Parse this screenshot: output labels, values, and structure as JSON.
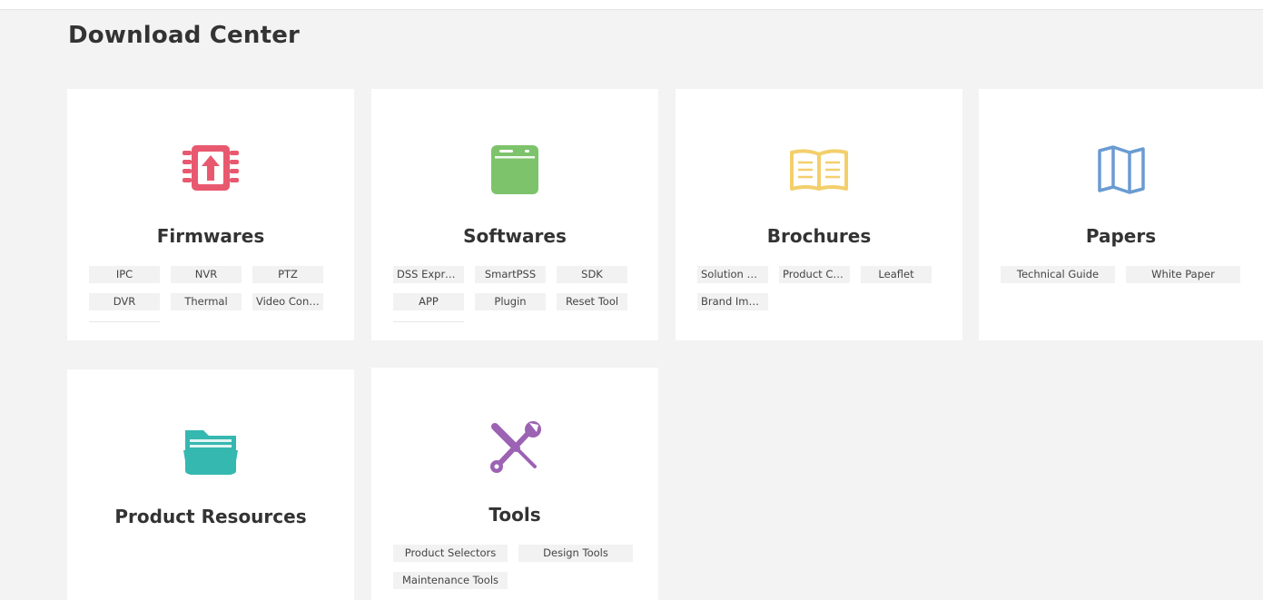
{
  "page": {
    "title": "Download Center"
  },
  "colors": {
    "firmwares": "#e8596f",
    "softwares": "#7dc36b",
    "brochures": "#f3cf6c",
    "papers": "#6a9bd2",
    "product_resources": "#35b8b0",
    "tools": "#9c62b3"
  },
  "cards": [
    {
      "title": "Firmwares",
      "icon": "chip-upload-icon",
      "tags": [
        "IPC",
        "NVR",
        "PTZ",
        "DVR",
        "Thermal",
        "Video Confe..."
      ]
    },
    {
      "title": "Softwares",
      "icon": "app-window-icon",
      "tags": [
        "DSS Express",
        "SmartPSS",
        "SDK",
        "APP",
        "Plugin",
        "Reset Tool"
      ]
    },
    {
      "title": "Brochures",
      "icon": "open-book-icon",
      "tags": [
        "Solution Cat...",
        "Product Cat...",
        "Leaflet",
        "Brand Image"
      ]
    },
    {
      "title": "Papers",
      "icon": "folded-map-icon",
      "tags": [
        "Technical Guide",
        "White Paper"
      ]
    },
    {
      "title": "Product Resources",
      "icon": "folder-icon",
      "tags": []
    },
    {
      "title": "Tools",
      "icon": "wrench-screwdriver-icon",
      "tags": [
        "Product Selectors",
        "Design Tools",
        "Maintenance Tools"
      ]
    }
  ]
}
